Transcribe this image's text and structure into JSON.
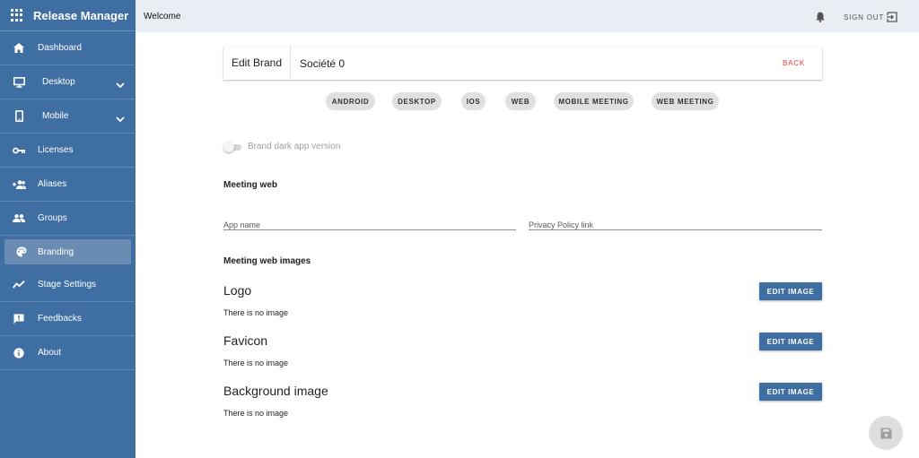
{
  "app": {
    "title": "Release Manager"
  },
  "sidebar": {
    "items": [
      {
        "label": "Dashboard",
        "icon": "home-icon"
      },
      {
        "label": "Desktop",
        "icon": "monitor-icon",
        "expandable": true
      },
      {
        "label": "Mobile",
        "icon": "phone-icon",
        "expandable": true
      },
      {
        "label": "Licenses",
        "icon": "key-icon"
      },
      {
        "label": "Aliases",
        "icon": "person-add-icon"
      },
      {
        "label": "Groups",
        "icon": "group-icon"
      },
      {
        "label": "Branding",
        "icon": "palette-icon",
        "active": true
      },
      {
        "label": "Stage Settings",
        "icon": "trend-icon"
      },
      {
        "label": "Feedbacks",
        "icon": "feedback-icon"
      },
      {
        "label": "About",
        "icon": "info-icon"
      }
    ]
  },
  "header": {
    "welcome": "Welcome",
    "sign_out": "SIGN OUT"
  },
  "card": {
    "title": "Edit Brand",
    "brand_name": "Société 0",
    "back": "BACK"
  },
  "chips": [
    "ANDROID",
    "DESKTOP",
    "IOS",
    "WEB",
    "MOBILE MEETING",
    "WEB MEETING"
  ],
  "toggle": {
    "label": "Brand dark app version",
    "checked": false
  },
  "meeting_web": {
    "title": "Meeting web",
    "app_name_placeholder": "App name",
    "privacy_placeholder": "Privacy Policy link"
  },
  "images": {
    "title": "Meeting web images",
    "rows": [
      {
        "title": "Logo",
        "note": "There is no image",
        "button": "EDIT IMAGE"
      },
      {
        "title": "Favicon",
        "note": "There is no image",
        "button": "EDIT IMAGE"
      },
      {
        "title": "Background image",
        "note": "There is no image",
        "button": "EDIT IMAGE"
      }
    ]
  },
  "colors": {
    "sidebar": "#3f6ea2",
    "active": "#6a8cb3",
    "header": "#e9edf4",
    "back": "#e53935"
  }
}
